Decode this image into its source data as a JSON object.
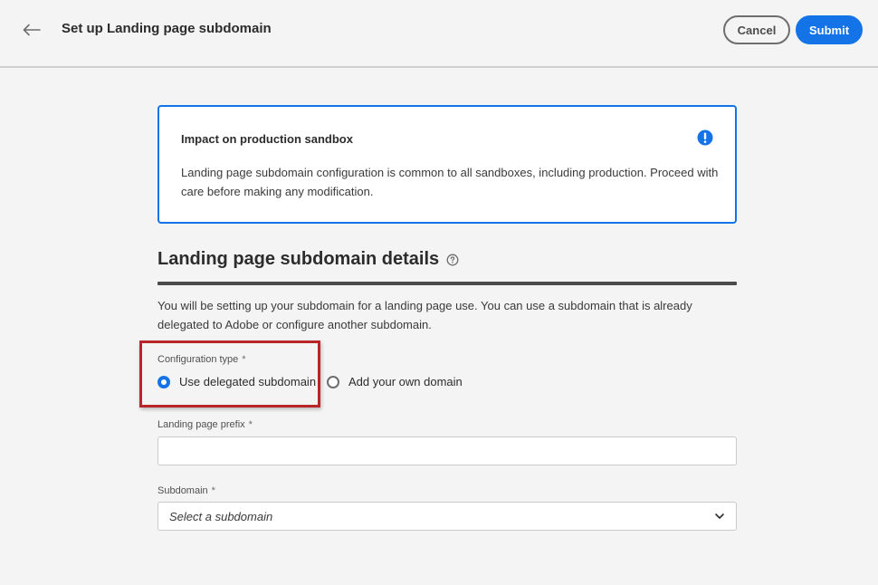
{
  "header": {
    "title": "Set up Landing page subdomain",
    "cancel_label": "Cancel",
    "submit_label": "Submit"
  },
  "alert": {
    "title": "Impact on production sandbox",
    "body": "Landing page subdomain configuration is common to all sandboxes, including production. Proceed with care before making any modification.",
    "icon": "alert-icon"
  },
  "section": {
    "title": "Landing page subdomain details",
    "description": "You will be setting up your subdomain for a landing page use. You can use a subdomain that is already delegated to Adobe or configure another subdomain."
  },
  "form": {
    "configuration_type": {
      "label": "Configuration type",
      "required_mark": "*",
      "options": [
        {
          "label": "Use delegated subdomain",
          "selected": true
        },
        {
          "label": "Add your own domain",
          "selected": false
        }
      ]
    },
    "prefix": {
      "label": "Landing page prefix",
      "required_mark": "*",
      "value": ""
    },
    "subdomain": {
      "label": "Subdomain",
      "required_mark": "*",
      "placeholder": "Select a subdomain"
    }
  },
  "colors": {
    "accent": "#1473e6",
    "highlight": "#b8262a"
  }
}
